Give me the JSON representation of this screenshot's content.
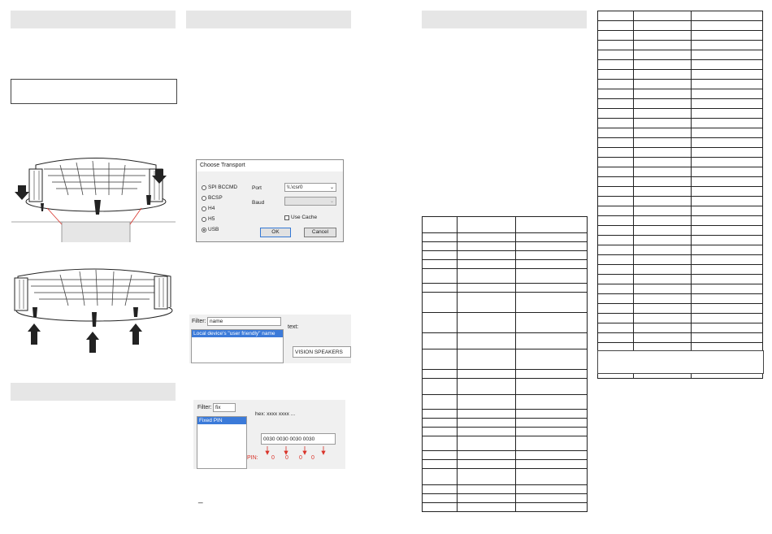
{
  "dialog": {
    "title": "Choose Transport",
    "options": [
      "SPI BCCMD",
      "BCSP",
      "H4",
      "H5",
      "USB"
    ],
    "selected": "USB",
    "port_label": "Port",
    "port_value": "\\\\.\\csr0",
    "baud_label": "Baud",
    "use_cache_label": "Use Cache",
    "ok_label": "OK",
    "cancel_label": "Cancel"
  },
  "name_filter": {
    "filter_label": "Filter:",
    "filter_value": "name",
    "list_item": "Local device's \"user friendly\" name",
    "text_label": "text:",
    "text_value": "VISION SPEAKERS"
  },
  "pin_filter": {
    "filter_label": "Filter:",
    "filter_value": "fix",
    "list_item": "Fixed PIN",
    "hex_label": "hex: xxxx xxxx ...",
    "hex_value": "0030 0030 0030 0030",
    "pin_label": "PIN:",
    "pin_digits": [
      "0",
      "0",
      "0",
      "0"
    ]
  },
  "footnote_mark": "_",
  "colors": {
    "header_bar": "#e6e6e6",
    "selection": "#3b7ad9",
    "pin_red": "#d9342b"
  }
}
